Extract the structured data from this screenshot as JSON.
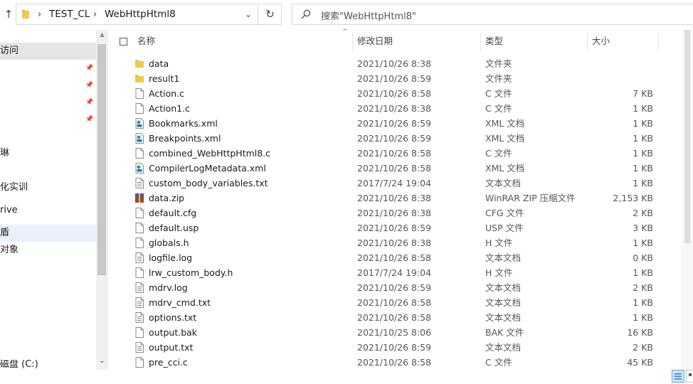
{
  "toolbar": {
    "breadcrumb": [
      "TEST_CL",
      "WebHttpHtml8"
    ],
    "search_placeholder": "搜索\"WebHttpHtml8\""
  },
  "nav": {
    "items": [
      {
        "label": "访问",
        "pinned": false
      },
      {
        "label": "",
        "pinned": true
      },
      {
        "label": "",
        "pinned": true
      },
      {
        "label": "",
        "pinned": true
      },
      {
        "label": "",
        "pinned": true
      },
      {
        "label": "琳",
        "pinned": false
      },
      {
        "label": "化实训",
        "pinned": false
      },
      {
        "label": "rive",
        "pinned": false
      },
      {
        "label": "盾",
        "pinned": false
      },
      {
        "label": "对象",
        "pinned": false
      },
      {
        "label": "磁盘 (C:)",
        "pinned": false
      }
    ]
  },
  "columns": {
    "name": "名称",
    "date": "修改日期",
    "type": "类型",
    "size": "大小"
  },
  "files": [
    {
      "name": "data",
      "date": "2021/10/26 8:38",
      "type": "文件夹",
      "size": "",
      "icon": "folder"
    },
    {
      "name": "result1",
      "date": "2021/10/26 8:59",
      "type": "文件夹",
      "size": "",
      "icon": "folder"
    },
    {
      "name": "Action.c",
      "date": "2021/10/26 8:58",
      "type": "C 文件",
      "size": "7 KB",
      "icon": "file"
    },
    {
      "name": "Action1.c",
      "date": "2021/10/26 8:38",
      "type": "C 文件",
      "size": "1 KB",
      "icon": "file"
    },
    {
      "name": "Bookmarks.xml",
      "date": "2021/10/26 8:59",
      "type": "XML 文档",
      "size": "1 KB",
      "icon": "xml"
    },
    {
      "name": "Breakpoints.xml",
      "date": "2021/10/26 8:59",
      "type": "XML 文档",
      "size": "1 KB",
      "icon": "xml"
    },
    {
      "name": "combined_WebHttpHtml8.c",
      "date": "2021/10/26 8:58",
      "type": "C 文件",
      "size": "1 KB",
      "icon": "file"
    },
    {
      "name": "CompilerLogMetadata.xml",
      "date": "2021/10/26 8:58",
      "type": "XML 文档",
      "size": "1 KB",
      "icon": "xml"
    },
    {
      "name": "custom_body_variables.txt",
      "date": "2017/7/24 19:04",
      "type": "文本文档",
      "size": "1 KB",
      "icon": "text"
    },
    {
      "name": "data.zip",
      "date": "2021/10/26 8:38",
      "type": "WinRAR ZIP 压缩文件",
      "size": "2,153 KB",
      "icon": "zip"
    },
    {
      "name": "default.cfg",
      "date": "2021/10/26 8:38",
      "type": "CFG 文件",
      "size": "2 KB",
      "icon": "file"
    },
    {
      "name": "default.usp",
      "date": "2021/10/26 8:59",
      "type": "USP 文件",
      "size": "3 KB",
      "icon": "file"
    },
    {
      "name": "globals.h",
      "date": "2021/10/26 8:38",
      "type": "H 文件",
      "size": "1 KB",
      "icon": "file"
    },
    {
      "name": "logfile.log",
      "date": "2021/10/26 8:58",
      "type": "文本文档",
      "size": "0 KB",
      "icon": "text"
    },
    {
      "name": "lrw_custom_body.h",
      "date": "2017/7/24 19:04",
      "type": "H 文件",
      "size": "1 KB",
      "icon": "file"
    },
    {
      "name": "mdrv.log",
      "date": "2021/10/26 8:59",
      "type": "文本文档",
      "size": "2 KB",
      "icon": "text"
    },
    {
      "name": "mdrv_cmd.txt",
      "date": "2021/10/26 8:58",
      "type": "文本文档",
      "size": "1 KB",
      "icon": "text"
    },
    {
      "name": "options.txt",
      "date": "2021/10/26 8:58",
      "type": "文本文档",
      "size": "1 KB",
      "icon": "text"
    },
    {
      "name": "output.bak",
      "date": "2021/10/25 8:06",
      "type": "BAK 文件",
      "size": "16 KB",
      "icon": "file"
    },
    {
      "name": "output.txt",
      "date": "2021/10/26 8:59",
      "type": "文本文档",
      "size": "2 KB",
      "icon": "text"
    },
    {
      "name": "pre_cci.c",
      "date": "2021/10/26 8:58",
      "type": "C 文件",
      "size": "45 KB",
      "icon": "file"
    }
  ],
  "colors": {
    "selected_nav": "#e5e5e5",
    "hover_nav": "#e8f1fb",
    "folder": "#f2c94c"
  }
}
